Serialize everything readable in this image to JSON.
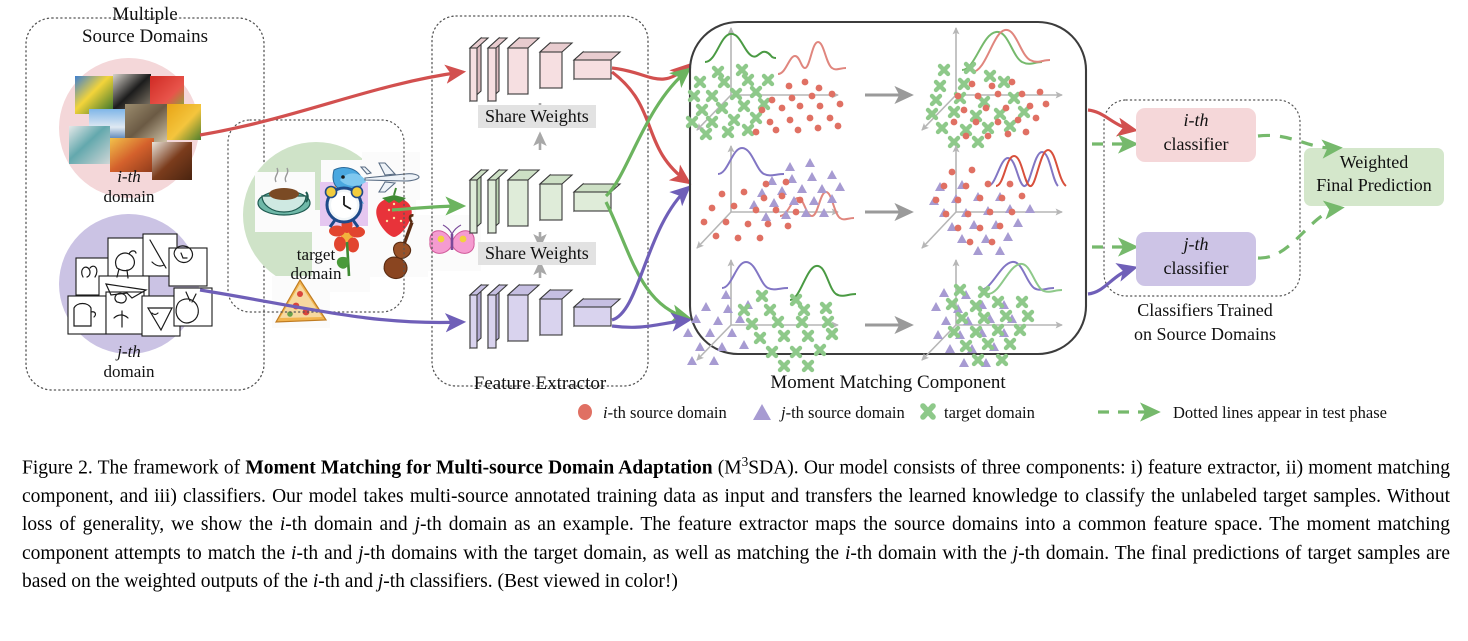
{
  "figure": {
    "groups": {
      "source_domains_title_line1": "Multiple",
      "source_domains_title_line2": "Source Domains",
      "i_domain_line1": "i-th",
      "i_domain_line2": "domain",
      "j_domain_line1": "j-th",
      "j_domain_line2": "domain",
      "target_domain_line1": "target",
      "target_domain_line2": "domain",
      "feature_extractor_label": "Feature Extractor",
      "share_weights_top": "Share Weights",
      "share_weights_bottom": "Share Weights",
      "moment_matching_label": "Moment Matching Component",
      "classifier_i_line1": "i-th",
      "classifier_i_line2": "classifier",
      "classifier_j_line1": "j-th",
      "classifier_j_line2": "classifier",
      "classifiers_note_line1": "Classifiers Trained",
      "classifiers_note_line2": "on Source Domains",
      "final_prediction_line1": "Weighted",
      "final_prediction_line2": "Final Prediction"
    },
    "legend": [
      {
        "marker": "circle",
        "color": "#e07063",
        "label_italic": "i",
        "label": "-th source domain"
      },
      {
        "marker": "triangle",
        "color": "#a79bd2",
        "label_italic": "j",
        "label": "-th source domain"
      },
      {
        "marker": "cross",
        "color": "#8ec98a",
        "label_italic": "",
        "label": "target domain"
      },
      {
        "marker": "dashed-arrow",
        "color": "#72b96a",
        "label_italic": "",
        "label": "Dotted lines appear in test phase"
      }
    ],
    "colors": {
      "source_i_fill": "#f4d7d9",
      "source_j_fill": "#cbc3e4",
      "target_fill": "#cfe3c8",
      "arrow_red": "#d2504f",
      "arrow_green": "#6cb45f",
      "arrow_purple": "#6f5fb8",
      "arrow_gray": "#9a9a9a",
      "dashed_green": "#76b96c",
      "marker_red": "#e07063",
      "marker_purple": "#a79bd2",
      "marker_green": "#8ec98a",
      "cnn_pink": "#f2d3d5",
      "cnn_green": "#d3e5cc",
      "cnn_purple": "#cfc8e6",
      "classifier_i_box": "#f5d7d9",
      "classifier_j_box": "#cdc4e6",
      "final_box": "#d4e7cb"
    }
  },
  "caption": {
    "figure_number": "Figure 2.",
    "text_1": " The framework of ",
    "bold_title": "Moment Matching for Multi-source Domain Adaptation",
    "text_2": " (M",
    "sup": "3",
    "text_3": "SDA). Our model consists of three components: i) feature extractor, ii) moment matching component, and iii) classifiers. Our model takes multi-source annotated training data as input and transfers the learned knowledge to classify the unlabeled target samples. Without loss of generality, we show the ",
    "it_i_1": "i",
    "text_4": "-th domain and ",
    "it_j_1": "j",
    "text_5": "-th domain as an example. The feature extractor maps the source domains into a common feature space. The moment matching component attempts to match the ",
    "it_i_2": "i",
    "text_6": "-th and ",
    "it_j_2": "j",
    "text_7": "-th domains with the target domain, as well as matching the ",
    "it_i_3": "i",
    "text_8": "-th domain with the ",
    "it_j_3": "j",
    "text_9": "-th domain. The final predictions of target samples are based on the weighted outputs of the ",
    "it_i_4": "i",
    "text_10": "-th and ",
    "it_j_4": "j",
    "text_11": "-th classifiers. (Best viewed in color!)"
  }
}
